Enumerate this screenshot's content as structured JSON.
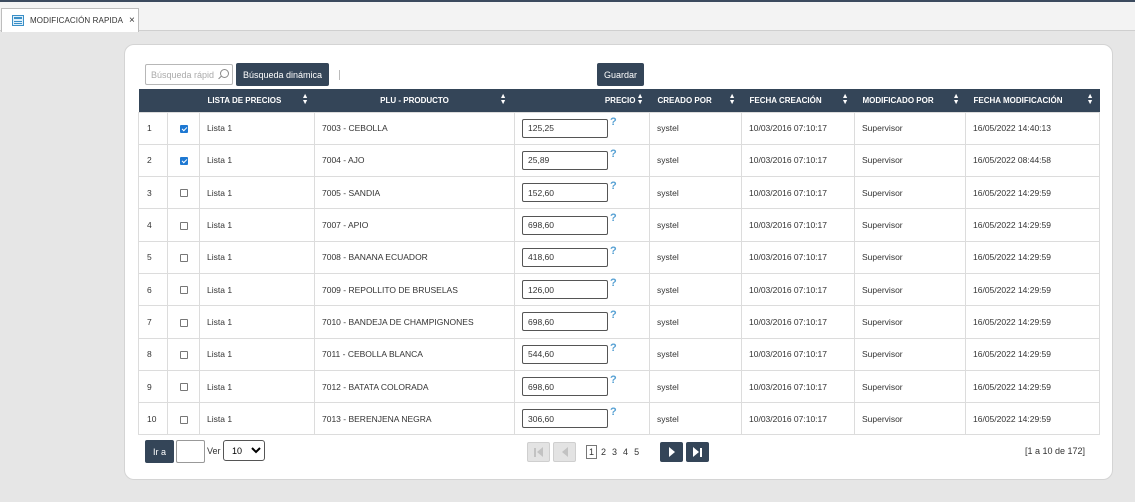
{
  "tab": {
    "label": "MODIFICACIÓN RAPIDA",
    "close": "×"
  },
  "toolbar": {
    "search_placeholder": "Búsqueda rápida",
    "dynamic_search_label": "Búsqueda dinámica",
    "save_label": "Guardar"
  },
  "table": {
    "headers": [
      "LISTA DE PRECIOS",
      "PLU - PRODUCTO",
      "PRECIO",
      "CREADO POR",
      "FECHA CREACIÓN",
      "MODIFICADO POR",
      "FECHA MODIFICACIÓN"
    ],
    "rows": [
      {
        "num": "1",
        "checked": true,
        "lista": "Lista 1",
        "producto": "7003 - CEBOLLA",
        "precio": "125,25",
        "creado": "systel",
        "fcreacion": "10/03/2016 07:10:17",
        "modificado": "Supervisor",
        "fmod": "16/05/2022 14:40:13"
      },
      {
        "num": "2",
        "checked": true,
        "lista": "Lista 1",
        "producto": "7004 - AJO",
        "precio": "25,89",
        "creado": "systel",
        "fcreacion": "10/03/2016 07:10:17",
        "modificado": "Supervisor",
        "fmod": "16/05/2022 08:44:58"
      },
      {
        "num": "3",
        "checked": false,
        "lista": "Lista 1",
        "producto": "7005 - SANDIA",
        "precio": "152,60",
        "creado": "systel",
        "fcreacion": "10/03/2016 07:10:17",
        "modificado": "Supervisor",
        "fmod": "16/05/2022 14:29:59"
      },
      {
        "num": "4",
        "checked": false,
        "lista": "Lista 1",
        "producto": "7007 - APIO",
        "precio": "698,60",
        "creado": "systel",
        "fcreacion": "10/03/2016 07:10:17",
        "modificado": "Supervisor",
        "fmod": "16/05/2022 14:29:59"
      },
      {
        "num": "5",
        "checked": false,
        "lista": "Lista 1",
        "producto": "7008 - BANANA ECUADOR",
        "precio": "418,60",
        "creado": "systel",
        "fcreacion": "10/03/2016 07:10:17",
        "modificado": "Supervisor",
        "fmod": "16/05/2022 14:29:59"
      },
      {
        "num": "6",
        "checked": false,
        "lista": "Lista 1",
        "producto": "7009 - REPOLLITO DE BRUSELAS",
        "precio": "126,00",
        "creado": "systel",
        "fcreacion": "10/03/2016 07:10:17",
        "modificado": "Supervisor",
        "fmod": "16/05/2022 14:29:59"
      },
      {
        "num": "7",
        "checked": false,
        "lista": "Lista 1",
        "producto": "7010 - BANDEJA DE CHAMPIGNONES",
        "precio": "698,60",
        "creado": "systel",
        "fcreacion": "10/03/2016 07:10:17",
        "modificado": "Supervisor",
        "fmod": "16/05/2022 14:29:59"
      },
      {
        "num": "8",
        "checked": false,
        "lista": "Lista 1",
        "producto": "7011 - CEBOLLA BLANCA",
        "precio": "544,60",
        "creado": "systel",
        "fcreacion": "10/03/2016 07:10:17",
        "modificado": "Supervisor",
        "fmod": "16/05/2022 14:29:59"
      },
      {
        "num": "9",
        "checked": false,
        "lista": "Lista 1",
        "producto": "7012 - BATATA COLORADA",
        "precio": "698,60",
        "creado": "systel",
        "fcreacion": "10/03/2016 07:10:17",
        "modificado": "Supervisor",
        "fmod": "16/05/2022 14:29:59"
      },
      {
        "num": "10",
        "checked": false,
        "lista": "Lista 1",
        "producto": "7013 - BERENJENA NEGRA",
        "precio": "306,60",
        "creado": "systel",
        "fcreacion": "10/03/2016 07:10:17",
        "modificado": "Supervisor",
        "fmod": "16/05/2022 14:29:59"
      }
    ]
  },
  "pager": {
    "goto_label": "Ir a",
    "goto_value": "",
    "ver_label": "Ver",
    "per_page": "10",
    "pages": [
      "1",
      "2",
      "3",
      "4",
      "5"
    ],
    "current_page": "1",
    "range_text": "[1 a 10 de 172]"
  },
  "colors": {
    "header_bg": "#344558",
    "checkbox_on": "#1e78d2",
    "help_icon": "#56a0d3"
  }
}
